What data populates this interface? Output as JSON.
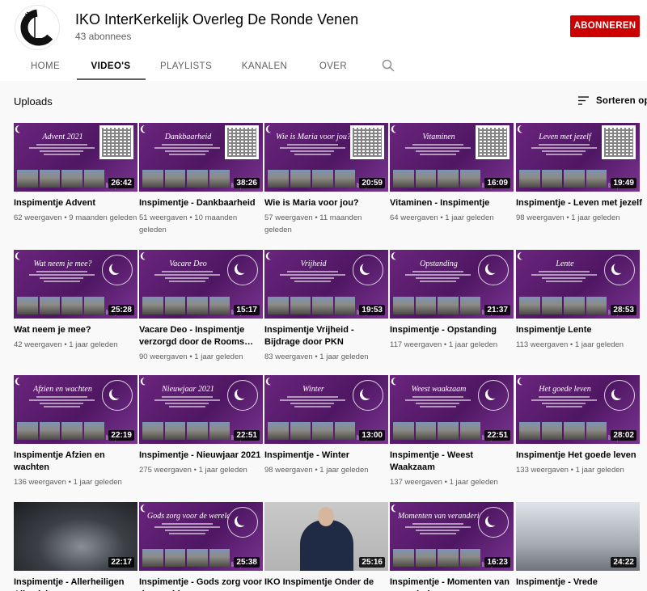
{
  "channel": {
    "name": "IKO InterKerkelijk Overleg De Ronde Venen",
    "subscribers": "43 abonnees",
    "subscribe_label": "ABONNEREN"
  },
  "tabs": [
    "HOME",
    "VIDEO'S",
    "PLAYLISTS",
    "KANALEN",
    "OVER"
  ],
  "active_tab": "VIDEO'S",
  "section": {
    "title": "Uploads",
    "sort_label": "Sorteren op"
  },
  "colors": {
    "accent": "#cc0000",
    "thumb_purple": "#5a1d72"
  },
  "icons": {
    "tab_search": "search-icon",
    "sort": "sort-lines-icon"
  },
  "videos": [
    {
      "title": "Inspimentje Advent",
      "thumb_text": "Advent 2021",
      "duration": "26:42",
      "views": "62 weergaven",
      "age": "9 maanden geleden",
      "thumb": "qr"
    },
    {
      "title": "Inspimentje - Dankbaarheid",
      "thumb_text": "Dankbaarheid",
      "duration": "38:26",
      "views": "51 weergaven",
      "age": "10 maanden geleden",
      "thumb": "qr"
    },
    {
      "title": "Wie is Maria voor jou?",
      "thumb_text": "Wie is Maria voor jou?",
      "duration": "20:59",
      "views": "57 weergaven",
      "age": "11 maanden geleden",
      "thumb": "qr"
    },
    {
      "title": "Vitaminen - Inspimentje",
      "thumb_text": "Vitaminen",
      "duration": "16:09",
      "views": "64 weergaven",
      "age": "1 jaar geleden",
      "thumb": "qr"
    },
    {
      "title": "Inspimentje - Leven met jezelf",
      "thumb_text": "Leven met jezelf",
      "duration": "19:49",
      "views": "98 weergaven",
      "age": "1 jaar geleden",
      "thumb": "qr"
    },
    {
      "title": "Wat neem je mee?",
      "thumb_text": "Wat neem je mee?",
      "duration": "25:28",
      "views": "42 weergaven",
      "age": "1 jaar geleden",
      "thumb": "seal"
    },
    {
      "title": "Vacare Deo - Inspimentje verzorgd door de Rooms…",
      "thumb_text": "Vacare Deo",
      "duration": "15:17",
      "views": "90 weergaven",
      "age": "1 jaar geleden",
      "thumb": "seal"
    },
    {
      "title": "Inspimentje Vrijheid - Bijdrage door PKN gemeent…",
      "thumb_text": "Vrijheid",
      "duration": "19:53",
      "views": "83 weergaven",
      "age": "1 jaar geleden",
      "thumb": "seal"
    },
    {
      "title": "Inspimentje - Opstanding",
      "thumb_text": "Opstanding",
      "duration": "21:37",
      "views": "117 weergaven",
      "age": "1 jaar geleden",
      "thumb": "seal"
    },
    {
      "title": "Inspimentje Lente",
      "thumb_text": "Lente",
      "duration": "28:53",
      "views": "113 weergaven",
      "age": "1 jaar geleden",
      "thumb": "seal"
    },
    {
      "title": "Inspimentje Afzien en wachten",
      "thumb_text": "Afzien en wachten",
      "duration": "22:19",
      "views": "136 weergaven",
      "age": "1 jaar geleden",
      "thumb": "seal"
    },
    {
      "title": "Inspimentje - Nieuwjaar 2021",
      "thumb_text": "Nieuwjaar 2021",
      "duration": "22:51",
      "views": "275 weergaven",
      "age": "1 jaar geleden",
      "thumb": "seal"
    },
    {
      "title": "Inspimentje - Winter",
      "thumb_text": "Winter",
      "duration": "13:00",
      "views": "98 weergaven",
      "age": "1 jaar geleden",
      "thumb": "seal"
    },
    {
      "title": "Inspimentje - Weest Waakzaam",
      "thumb_text": "Weest waakzaam",
      "duration": "22:51",
      "views": "137 weergaven",
      "age": "1 jaar geleden",
      "thumb": "seal"
    },
    {
      "title": "Inspimentje Het goede leven",
      "thumb_text": "Het goede leven",
      "duration": "28:02",
      "views": "133 weergaven",
      "age": "1 jaar geleden",
      "thumb": "seal"
    },
    {
      "title": "Inspimentje - Allerheiligen Allerzielen",
      "thumb_text": "",
      "duration": "22:17",
      "views": "",
      "age": "",
      "thumb": "photo-dark"
    },
    {
      "title": "Inspimentje - Gods zorg voor de wereld",
      "thumb_text": "Gods zorg voor de wereld",
      "duration": "25:38",
      "views": "",
      "age": "",
      "thumb": "seal"
    },
    {
      "title": "IKO Inspimentje Onder de",
      "thumb_text": "",
      "duration": "25:16",
      "views": "",
      "age": "",
      "thumb": "photo-priest"
    },
    {
      "title": "Inspimentje - Momenten van verandering",
      "thumb_text": "Momenten van verandering",
      "duration": "16:23",
      "views": "",
      "age": "",
      "thumb": "seal"
    },
    {
      "title": "Inspimentje - Vrede",
      "thumb_text": "",
      "duration": "24:22",
      "views": "",
      "age": "",
      "thumb": "photo-street"
    }
  ]
}
